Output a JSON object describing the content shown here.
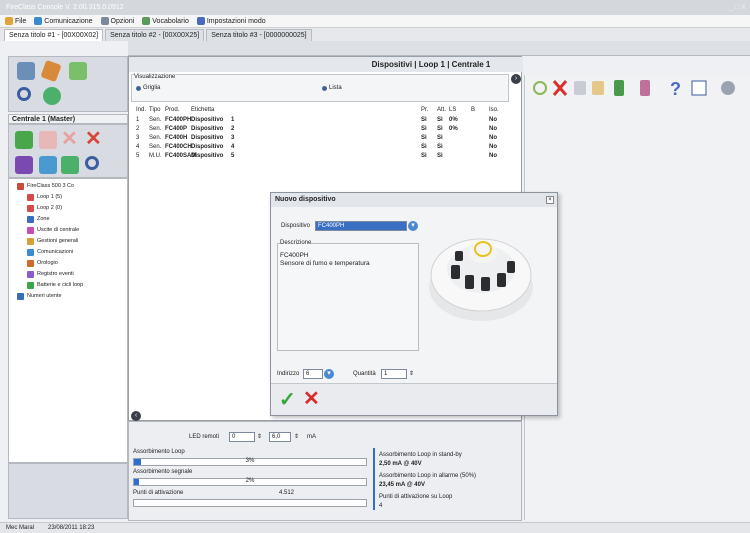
{
  "window": {
    "title": "FireClass Console V. 2.00.315.0.0912",
    "controls": "_ □ X"
  },
  "menu": {
    "file": "File",
    "comunicazione": "Comunicazione",
    "opzioni": "Opzioni",
    "vocabolario": "Vocabolario",
    "impostazioni": "Impostazioni modo"
  },
  "tabs": [
    "Senza titolo #1 - [00X00X02]",
    "Senza titolo #2 - [00X00X25]",
    "Senza titolo #3 - [0000000025]"
  ],
  "main_header": "Dispositivi | Loop 1 | Centrale 1",
  "left": {
    "centrale_title": "Centrale 1 (Master)"
  },
  "tree": [
    {
      "label": "FireClass 500 3 Co",
      "color": "#c94b3b"
    },
    {
      "label": "Loop 1 (5)",
      "color": "#d64a4a"
    },
    {
      "label": "Loop 2 (0)",
      "color": "#d64a4a"
    },
    {
      "label": "Zone",
      "color": "#3b6cc4"
    },
    {
      "label": "Uscite di centrale",
      "color": "#c94bb5"
    },
    {
      "label": "Gestioni generali",
      "color": "#d9a033"
    },
    {
      "label": "Comunicazioni",
      "color": "#3b8cd0"
    },
    {
      "label": "Orologio",
      "color": "#d06a2c"
    },
    {
      "label": "Registro eventi",
      "color": "#8a5cc9"
    },
    {
      "label": "Batterie e cicli loop",
      "color": "#3aa64a"
    },
    {
      "label": "Numeri utente",
      "color": "#3b6cc4"
    }
  ],
  "visualizzazione": {
    "label": "Visualizzazione",
    "griglia": "Griglia",
    "lista": "Lista"
  },
  "grid": {
    "headers": [
      "Ind.",
      "Tipo",
      "Prod.",
      "Etichetta",
      "Pr.",
      "Att.",
      "LS",
      "B",
      "Iso."
    ],
    "rows": [
      [
        "1",
        "Sen.",
        "FC400PH",
        "Dispositivo",
        "1",
        "Sì",
        "Sì",
        "0%",
        "",
        "No"
      ],
      [
        "2",
        "Sen.",
        "FC400P",
        "Dispositivo",
        "2",
        "Sì",
        "Sì",
        "0%",
        "",
        "No"
      ],
      [
        "3",
        "Sen.",
        "FC400H",
        "Dispositivo",
        "3",
        "Sì",
        "Sì",
        "",
        "",
        "No"
      ],
      [
        "4",
        "Sen.",
        "FC400CH",
        "Dispositivo",
        "4",
        "Sì",
        "Sì",
        "",
        "",
        "No"
      ],
      [
        "5",
        "M.U.",
        "FC400SAM",
        "Dispositivo",
        "5",
        "Sì",
        "Sì",
        "",
        "",
        "No"
      ]
    ]
  },
  "dialog": {
    "title": "Nuovo dispositivo",
    "dispositivo_label": "Dispositivo",
    "dispositivo_value": "FC400PH",
    "descrizione_label": "Descrizione",
    "desc_line1": "FC400PH",
    "desc_line2": "Sensore di fumo e temperatura",
    "indirizzo_label": "Indirizzo",
    "indirizzo_value": "6",
    "quantita_label": "Quantità",
    "quantita_value": "1"
  },
  "bottom": {
    "led_label": "LED remoti",
    "led_value": "0",
    "ma_value": "6,0",
    "ma_unit": "mA",
    "assorbimento_loop": "Assorbimento Loop",
    "assorbimento_loop_pct": "3%",
    "assorbimento_loop_fill": 0.03,
    "assorbimento_segnale": "Assorbimento segnale",
    "assorbimento_segnale_pct": "2%",
    "assorbimento_segnale_fill": 0.02,
    "punti_label": "Punti di attivazione",
    "punti_value": "4.512",
    "r1_label": "Assorbimento Loop in stand-by",
    "r1_value": "2,50 mA @ 40V",
    "r2_label": "Assorbimento Loop in allarme (50%)",
    "r2_value": "23,45 mA @ 40V",
    "r3_label": "Punti di attivazione su Loop",
    "r3_value": "4"
  },
  "status": {
    "user": "Mec Maral",
    "datetime": "23/08/2011 18:23"
  }
}
